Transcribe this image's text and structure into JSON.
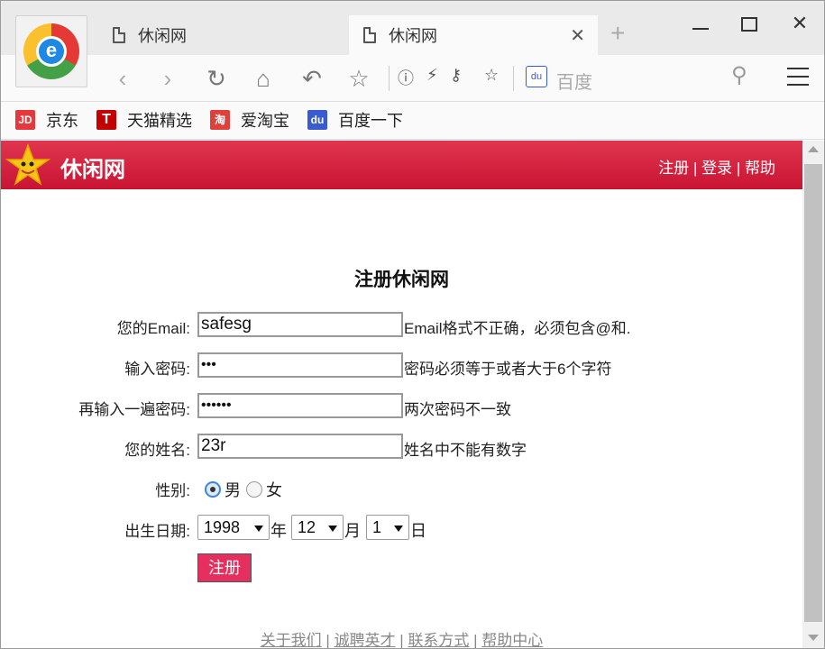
{
  "browser": {
    "tabs": [
      {
        "title": "休闲网",
        "active": false
      },
      {
        "title": "休闲网",
        "active": true
      }
    ],
    "new_tab": "+",
    "window_controls": {
      "minimize": "minimize-icon",
      "maximize": "maximize-icon",
      "close": "✕"
    },
    "search_engine_label": "百度",
    "bookmarks": [
      {
        "label": "京东",
        "icon": "JD"
      },
      {
        "label": "天猫精选",
        "icon": "T"
      },
      {
        "label": "爱淘宝",
        "icon": "淘"
      },
      {
        "label": "百度一下",
        "icon": "du"
      }
    ]
  },
  "site": {
    "name": "休闲网",
    "nav": {
      "register": "注册",
      "sep1": " | ",
      "login": "登录",
      "sep2": " | ",
      "help": "帮助"
    }
  },
  "form": {
    "title": "注册休闲网",
    "email": {
      "label": "您的Email:",
      "value": "safesg",
      "message": "Email格式不正确，必须包含@和."
    },
    "password": {
      "label": "输入密码:",
      "value": "•••",
      "message": "密码必须等于或者大于6个字符"
    },
    "confirm_password": {
      "label": "再输入一遍密码:",
      "value": "••••••",
      "message": "两次密码不一致"
    },
    "name": {
      "label": "您的姓名:",
      "value": "23r",
      "message": "姓名中不能有数字"
    },
    "gender": {
      "label": "性别:",
      "options": [
        "男",
        "女"
      ],
      "selected": "男"
    },
    "birthday": {
      "label": "出生日期:",
      "year": "1998",
      "year_unit": "年",
      "month": "12",
      "month_unit": "月",
      "day": "1",
      "day_unit": "日"
    },
    "submit_label": "注册"
  },
  "footer": {
    "links": [
      "关于我们",
      "诚聘英才",
      "联系方式",
      "帮助中心"
    ],
    "separator": " | "
  },
  "colors": {
    "header_red": "#c81433",
    "submit_pink": "#e5305f"
  }
}
